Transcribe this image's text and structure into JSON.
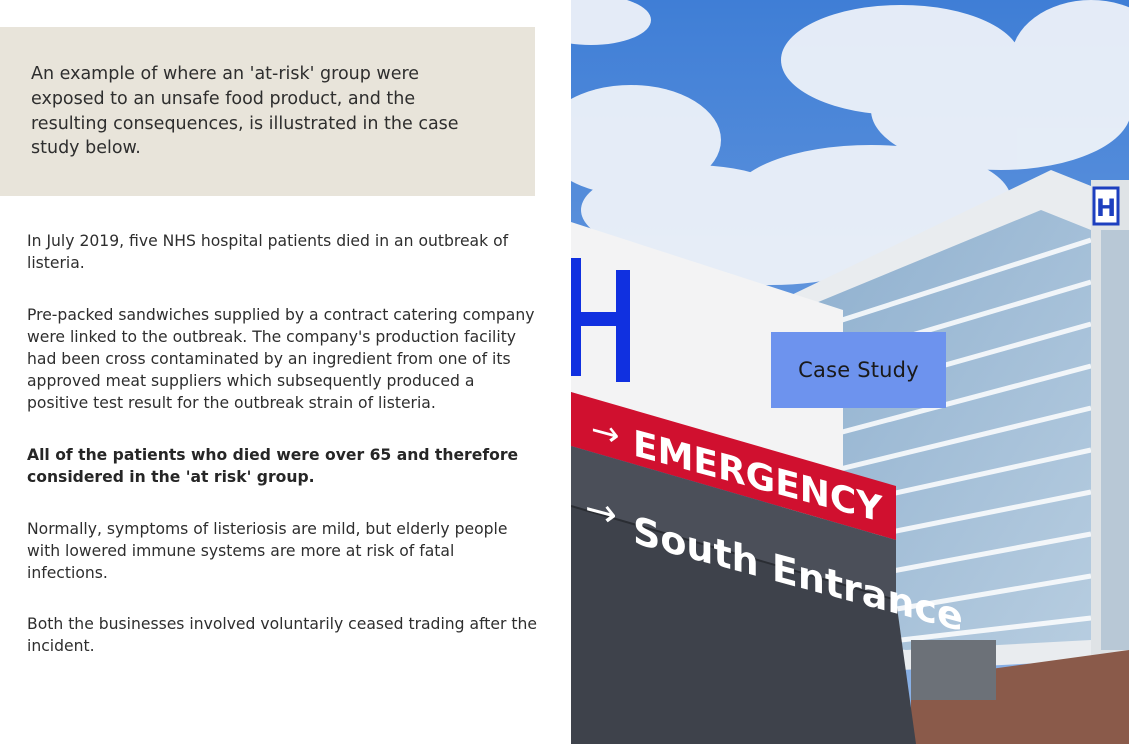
{
  "intro": {
    "text": "An example of where an 'at-risk' group were exposed to an unsafe food product, and the resulting consequences, is illustrated in the case study below."
  },
  "paragraphs": [
    {
      "text": "In July 2019, five NHS hospital patients died in an outbreak of listeria.",
      "bold": false
    },
    {
      "text": "Pre-packed sandwiches supplied by a contract catering company were linked to the outbreak. The company's production facility had been cross contaminated by an ingredient from one of its approved meat suppliers which subsequently produced a positive test result for the outbreak strain of listeria.",
      "bold": false
    },
    {
      "text": "All of the patients who died were over 65 and therefore considered in the 'at risk' group.",
      "bold": true
    },
    {
      "text": "Normally, symptoms of listeriosis are mild, but elderly people with lowered immune systems are more at risk of fatal infections.",
      "bold": false
    },
    {
      "text": "Both the businesses involved voluntarily ceased trading after the incident.",
      "bold": false
    }
  ],
  "hero": {
    "badge_label": "Case Study",
    "sign_emergency": "EMERGENCY",
    "sign_south": "South Entrance",
    "sign_h_letter": "H",
    "building_h_letter": "H",
    "colors": {
      "sky": "#4f8ad8",
      "sign_red": "#d0102f",
      "sign_gray": "#4b4f59",
      "badge": "#6d93ee",
      "h_blue": "#1030e0"
    }
  }
}
